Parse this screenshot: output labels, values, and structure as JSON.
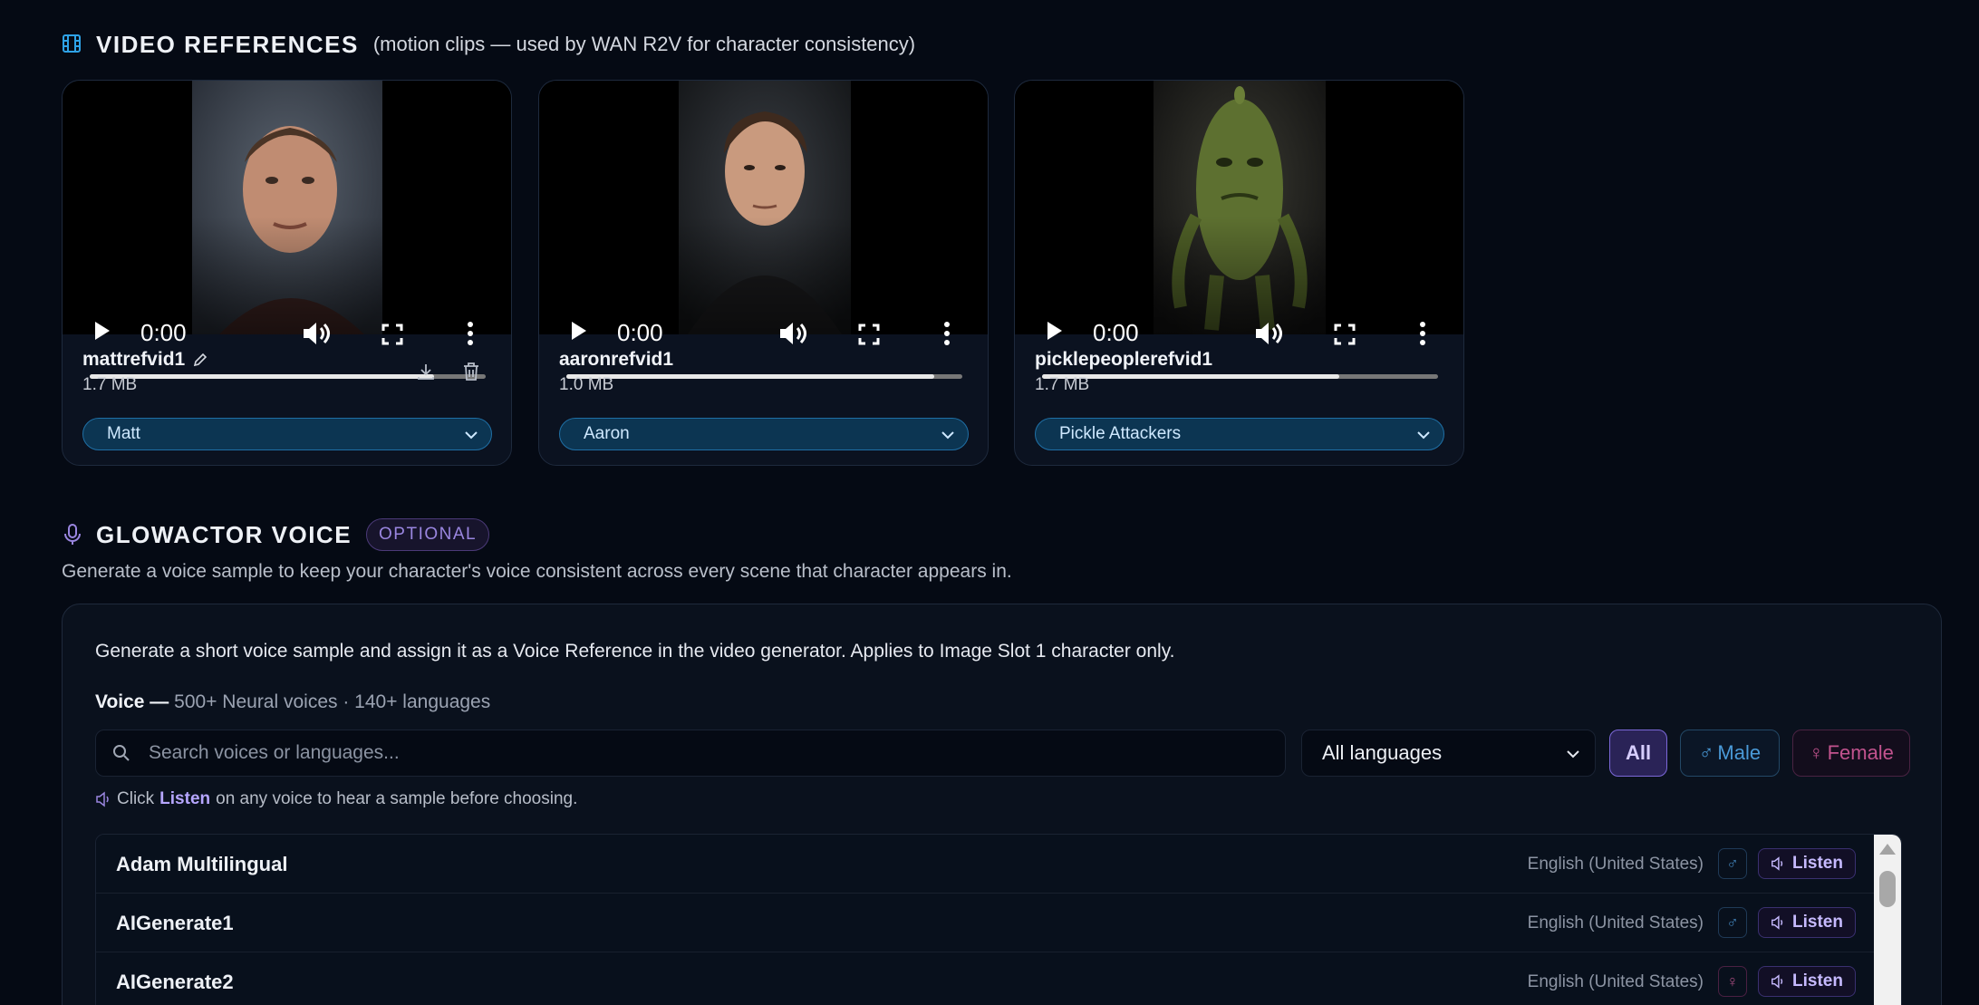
{
  "video_references": {
    "title": "VIDEO REFERENCES",
    "subtitle": "(motion clips — used by WAN R2V for character consistency)",
    "cards": [
      {
        "name": "mattrefvid1",
        "size": "1.7 MB",
        "time": "0:00",
        "progress": 0.87,
        "character": "Matt",
        "editable": true
      },
      {
        "name": "aaronrefvid1",
        "size": "1.0 MB",
        "time": "0:00",
        "progress": 0.93,
        "character": "Aaron",
        "editable": false
      },
      {
        "name": "picklepeoplerefvid1",
        "size": "1.7 MB",
        "time": "0:00",
        "progress": 0.75,
        "character": "Pickle Attackers",
        "editable": false
      }
    ]
  },
  "glowactor_voice": {
    "title": "GLOWACTOR VOICE",
    "badge": "OPTIONAL",
    "description": "Generate a voice sample to keep your character's voice consistent across every scene that character appears in.",
    "intro": "Generate a short voice sample and assign it as a Voice Reference in the video generator. Applies to Image Slot 1 character only.",
    "voice_label": "Voice —",
    "voice_stats": "500+ Neural voices · 140+ languages",
    "search_placeholder": "Search voices or languages...",
    "language_filter": "All languages",
    "filters": {
      "all": "All",
      "male": "Male",
      "female": "Female"
    },
    "hint_prefix": "Click",
    "hint_keyword": "Listen",
    "hint_suffix": "on any voice to hear a sample before choosing.",
    "voices": [
      {
        "name": "Adam Multilingual",
        "language": "English (United States)",
        "gender": "male",
        "listen": "Listen"
      },
      {
        "name": "AIGenerate1",
        "language": "English (United States)",
        "gender": "male",
        "listen": "Listen"
      },
      {
        "name": "AIGenerate2",
        "language": "English (United States)",
        "gender": "female",
        "listen": "Listen"
      }
    ]
  },
  "colors": {
    "background": "#050a14",
    "accent_blue": "#2aa0e0",
    "accent_purple": "#7b68d8",
    "male": "#4a9ad8",
    "female": "#c2538e"
  }
}
